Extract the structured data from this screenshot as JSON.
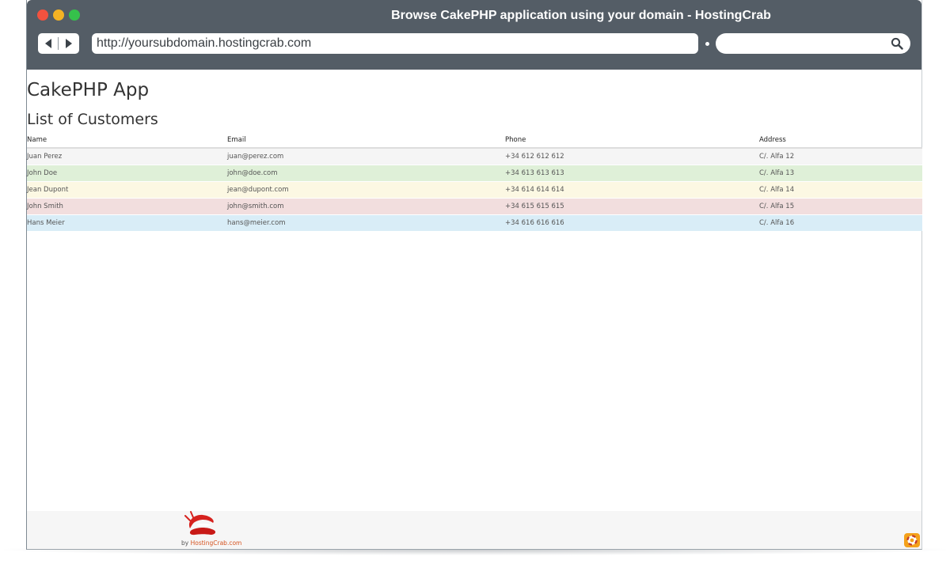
{
  "window": {
    "title": "Browse CakePHP application using your domain - HostingCrab",
    "url": "http://yoursubdomain.hostingcrab.com",
    "search_value": ""
  },
  "page": {
    "app_title": "CakePHP App",
    "list_title": "List of Customers",
    "table": {
      "columns": [
        "Name",
        "Email",
        "Phone",
        "Address"
      ],
      "rows": [
        {
          "name": "Juan Perez",
          "email": "juan@perez.com",
          "phone": "+34 612 612 612",
          "address": "C/. Alfa 12",
          "style": "default"
        },
        {
          "name": "John Doe",
          "email": "john@doe.com",
          "phone": "+34 613 613 613",
          "address": "C/. Alfa 13",
          "style": "success"
        },
        {
          "name": "Jean Dupont",
          "email": "jean@dupont.com",
          "phone": "+34 614 614 614",
          "address": "C/. Alfa 14",
          "style": "warning"
        },
        {
          "name": "John Smith",
          "email": "john@smith.com",
          "phone": "+34 615 615 615",
          "address": "C/. Alfa 15",
          "style": "danger"
        },
        {
          "name": "Hans Meier",
          "email": "hans@meier.com",
          "phone": "+34 616 616 616",
          "address": "C/. Alfa 16",
          "style": "info"
        }
      ]
    }
  },
  "footer": {
    "by_label": "by",
    "brand": "HostingCrab.com",
    "logo_icon": "crab-claw-logo",
    "help_icon": "lifebuoy-icon"
  },
  "colors": {
    "titlebar": "#545d66",
    "row_default": "#f5f5f5",
    "row_success": "#dff0d8",
    "row_warning": "#fcf8e3",
    "row_danger": "#f2dede",
    "row_info": "#d9edf7",
    "brand": "#d5531f"
  }
}
